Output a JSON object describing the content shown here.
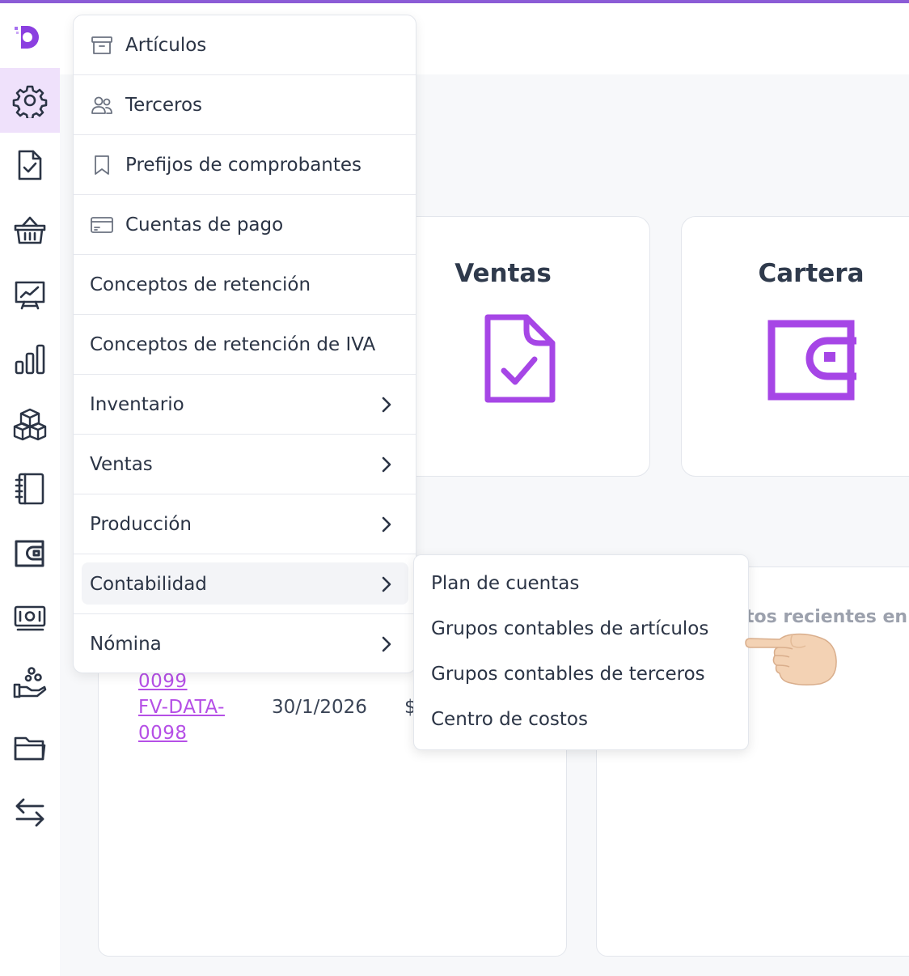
{
  "menu": {
    "items": [
      {
        "label": "Artículos",
        "icon": "archive-icon",
        "has_submenu": false
      },
      {
        "label": "Terceros",
        "icon": "users-icon",
        "has_submenu": false
      },
      {
        "label": "Prefijos de comprobantes",
        "icon": "bookmark-icon",
        "has_submenu": false
      },
      {
        "label": "Cuentas de pago",
        "icon": "credit-card-icon",
        "has_submenu": false
      },
      {
        "label": "Conceptos de retención",
        "has_submenu": false
      },
      {
        "label": "Conceptos de retención de IVA",
        "has_submenu": false
      },
      {
        "label": "Inventario",
        "has_submenu": true
      },
      {
        "label": "Ventas",
        "has_submenu": true
      },
      {
        "label": "Producción",
        "has_submenu": true
      },
      {
        "label": "Contabilidad",
        "has_submenu": true,
        "highlighted": true
      },
      {
        "label": "Nómina",
        "has_submenu": true
      }
    ]
  },
  "submenu": {
    "items": [
      {
        "label": "Plan de cuentas"
      },
      {
        "label": "Grupos contables de artículos"
      },
      {
        "label": "Grupos contables de terceros"
      },
      {
        "label": "Centro de costos"
      }
    ]
  },
  "cards": {
    "ventas": {
      "title": "Ventas",
      "icon": "document-check-icon"
    },
    "cartera": {
      "title": "Cartera",
      "icon": "wallet-icon"
    }
  },
  "recent_table": {
    "rows": [
      {
        "doc_line1": "0099"
      },
      {
        "doc_line1": "FV-DATA-",
        "doc_line2": "0098",
        "date": "30/1/2026",
        "amount_prefix": "$"
      }
    ]
  },
  "right_panel": {
    "title_fragment": "tos recientes en c"
  },
  "sidebar": {
    "icons": [
      "logo-icon",
      "gear-icon",
      "document-check-icon",
      "basket-icon",
      "presentation-chart-icon",
      "bar-chart-icon",
      "boxes-icon",
      "notebook-icon",
      "wallet-icon",
      "money-icon",
      "hand-coins-icon",
      "folder-icon",
      "transfer-icon"
    ]
  },
  "colors": {
    "accent": "#a646e6",
    "active_bg": "#efe1fb",
    "link": "#b54fe6",
    "text": "#2b3445"
  }
}
